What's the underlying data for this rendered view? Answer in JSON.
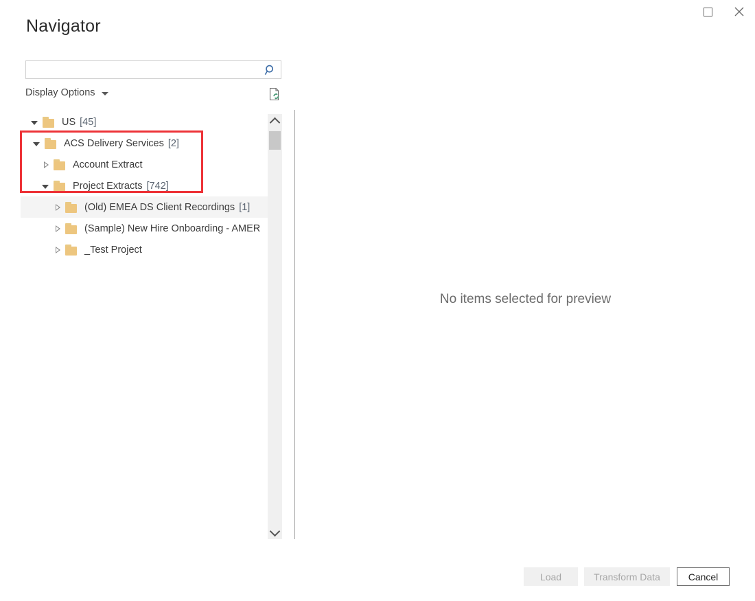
{
  "window": {
    "title": "Navigator",
    "controls": [
      {
        "name": "maximize-button",
        "icon": "maximize-icon",
        "label": ""
      },
      {
        "name": "close-button",
        "icon": "close-icon",
        "label": "✕"
      }
    ]
  },
  "search": {
    "value": "",
    "placeholder": "",
    "icon": "search-icon",
    "icon_color": "#3e6ea8"
  },
  "toolbar": {
    "display_options_label": "Display Options",
    "display_options_caret": "chevron-down-icon",
    "refresh_icon": "refresh-document-icon",
    "refresh_icon_color": "#4a9b78"
  },
  "tree": {
    "items": [
      {
        "label": "US",
        "count": "[45]",
        "level": 0,
        "state": "expanded",
        "icon": "folder-icon",
        "hovered": false,
        "highlighted": false
      },
      {
        "label": "ACS Delivery Services",
        "count": "[2]",
        "level": 1,
        "state": "expanded",
        "icon": "folder-icon",
        "hovered": false,
        "highlighted": true
      },
      {
        "label": "Account Extract",
        "count": "",
        "level": 2,
        "state": "collapsed",
        "icon": "folder-icon",
        "hovered": false,
        "highlighted": true
      },
      {
        "label": "Project Extracts",
        "count": "[742]",
        "level": 2,
        "state": "expanded",
        "icon": "folder-icon",
        "hovered": false,
        "highlighted": true
      },
      {
        "label": "(Old) EMEA DS Client Recordings",
        "count": "[1]",
        "level": 3,
        "state": "collapsed",
        "icon": "folder-icon",
        "hovered": true,
        "highlighted": false
      },
      {
        "label": "(Sample) New Hire Onboarding - AMER",
        "count": "",
        "level": 3,
        "state": "collapsed",
        "icon": "folder-icon",
        "hovered": false,
        "highlighted": false
      },
      {
        "label": "_Test Project",
        "count": "",
        "level": 3,
        "state": "collapsed",
        "icon": "folder-icon",
        "hovered": false,
        "highlighted": false
      }
    ],
    "highlight_color": "#ed3237"
  },
  "scrollbar": {
    "up_icon": "chevron-up-icon",
    "down_icon": "chevron-down-icon",
    "thumb_position_percent": 4
  },
  "preview": {
    "empty_text": "No items selected for preview"
  },
  "footer": {
    "load_label": "Load",
    "load_enabled": false,
    "transform_label": "Transform Data",
    "transform_enabled": false,
    "cancel_label": "Cancel",
    "cancel_enabled": true
  }
}
